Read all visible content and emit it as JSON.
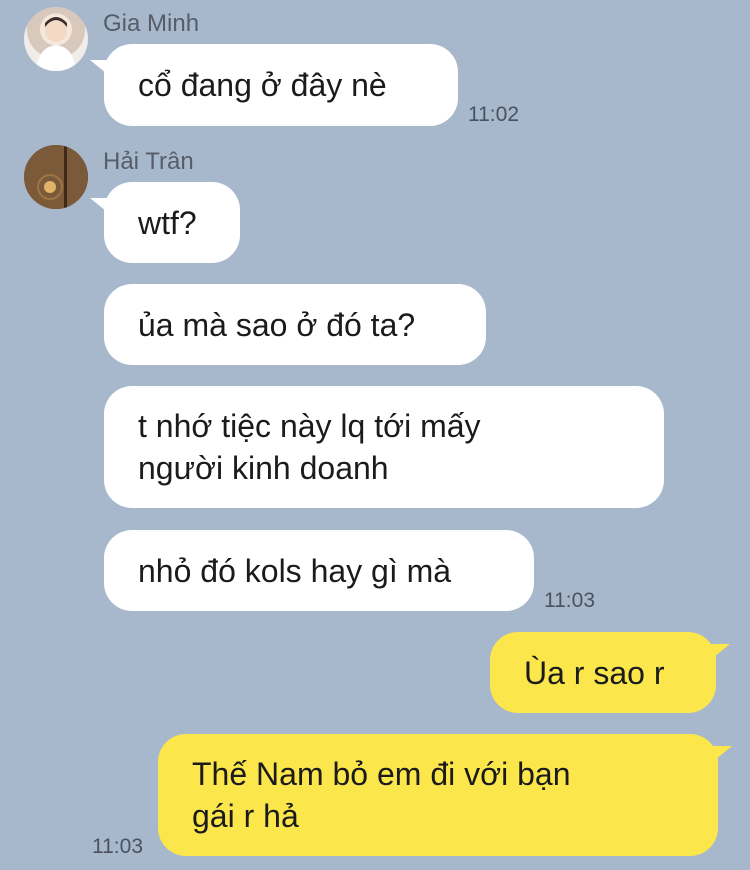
{
  "colors": {
    "background": "#a8b8cc",
    "incoming_bubble": "#ffffff",
    "outgoing_bubble": "#fbe64c"
  },
  "messages": [
    {
      "sender": "Gia Minh",
      "text": "cổ đang ở đây nè",
      "time": "11:02"
    },
    {
      "sender": "Hải Trân",
      "text": "wtf?"
    },
    {
      "text": "ủa mà sao ở đó ta?"
    },
    {
      "text": "t nhớ tiệc này lq tới mấy\nngười kinh doanh"
    },
    {
      "text": "nhỏ đó kols hay gì mà",
      "time": "11:03"
    },
    {
      "text": "Ùa r sao r"
    },
    {
      "text": "Thế Nam bỏ em đi với bạn\ngái r hả",
      "time": "11:03"
    }
  ]
}
